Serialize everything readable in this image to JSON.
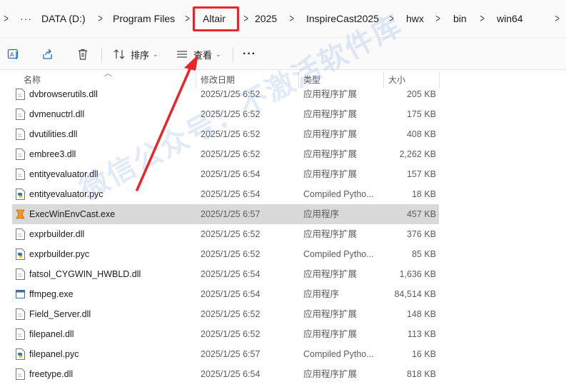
{
  "breadcrumb": {
    "items": [
      "DATA (D:)",
      "Program Files",
      "Altair",
      "2025",
      "InspireCast2025",
      "hwx",
      "bin",
      "win64"
    ],
    "overflow_label": "···",
    "left_chevron": ">"
  },
  "toolbar": {
    "sort_label": "排序",
    "view_label": "查看",
    "more_label": "···"
  },
  "columns": {
    "name": "名称",
    "date": "修改日期",
    "type": "类型",
    "size": "大小"
  },
  "files": [
    {
      "name": "dvbrowserutils.dll",
      "date": "2025/1/25 6:52",
      "type": "应用程序扩展",
      "size": "205 KB",
      "icon": "dll-file-icon"
    },
    {
      "name": "dvmenuctrl.dll",
      "date": "2025/1/25 6:52",
      "type": "应用程序扩展",
      "size": "175 KB",
      "icon": "dll-file-icon"
    },
    {
      "name": "dvutilities.dll",
      "date": "2025/1/25 6:52",
      "type": "应用程序扩展",
      "size": "408 KB",
      "icon": "dll-file-icon"
    },
    {
      "name": "embree3.dll",
      "date": "2025/1/25 6:52",
      "type": "应用程序扩展",
      "size": "2,262 KB",
      "icon": "dll-file-icon"
    },
    {
      "name": "entityevaluator.dll",
      "date": "2025/1/25 6:54",
      "type": "应用程序扩展",
      "size": "157 KB",
      "icon": "dll-file-icon"
    },
    {
      "name": "entityevaluator.pyc",
      "date": "2025/1/25 6:54",
      "type": "Compiled Pytho...",
      "size": "18 KB",
      "icon": "python-file-icon"
    },
    {
      "name": "ExecWinEnvCast.exe",
      "date": "2025/1/25 6:57",
      "type": "应用程序",
      "size": "457 KB",
      "icon": "app-exe-icon",
      "selected": true
    },
    {
      "name": "exprbuilder.dll",
      "date": "2025/1/25 6:52",
      "type": "应用程序扩展",
      "size": "376 KB",
      "icon": "dll-file-icon"
    },
    {
      "name": "exprbuilder.pyc",
      "date": "2025/1/25 6:52",
      "type": "Compiled Pytho...",
      "size": "85 KB",
      "icon": "python-file-icon"
    },
    {
      "name": "fatsol_CYGWIN_HWBLD.dll",
      "date": "2025/1/25 6:54",
      "type": "应用程序扩展",
      "size": "1,636 KB",
      "icon": "dll-file-icon"
    },
    {
      "name": "ffmpeg.exe",
      "date": "2025/1/25 6:54",
      "type": "应用程序",
      "size": "84,514 KB",
      "icon": "exe-window-icon"
    },
    {
      "name": "Field_Server.dll",
      "date": "2025/1/25 6:52",
      "type": "应用程序扩展",
      "size": "148 KB",
      "icon": "dll-file-icon"
    },
    {
      "name": "filepanel.dll",
      "date": "2025/1/25 6:52",
      "type": "应用程序扩展",
      "size": "113 KB",
      "icon": "dll-file-icon"
    },
    {
      "name": "filepanel.pyc",
      "date": "2025/1/25 6:57",
      "type": "Compiled Pytho...",
      "size": "16 KB",
      "icon": "python-file-icon"
    },
    {
      "name": "freetype.dll",
      "date": "2025/1/25 6:54",
      "type": "应用程序扩展",
      "size": "818 KB",
      "icon": "dll-file-icon"
    }
  ],
  "watermark": "微信公众号：不激活软件库",
  "colors": {
    "highlight": "#e8262a",
    "selected_row": "#d9d9d9",
    "watermark": "#78a0dc"
  }
}
